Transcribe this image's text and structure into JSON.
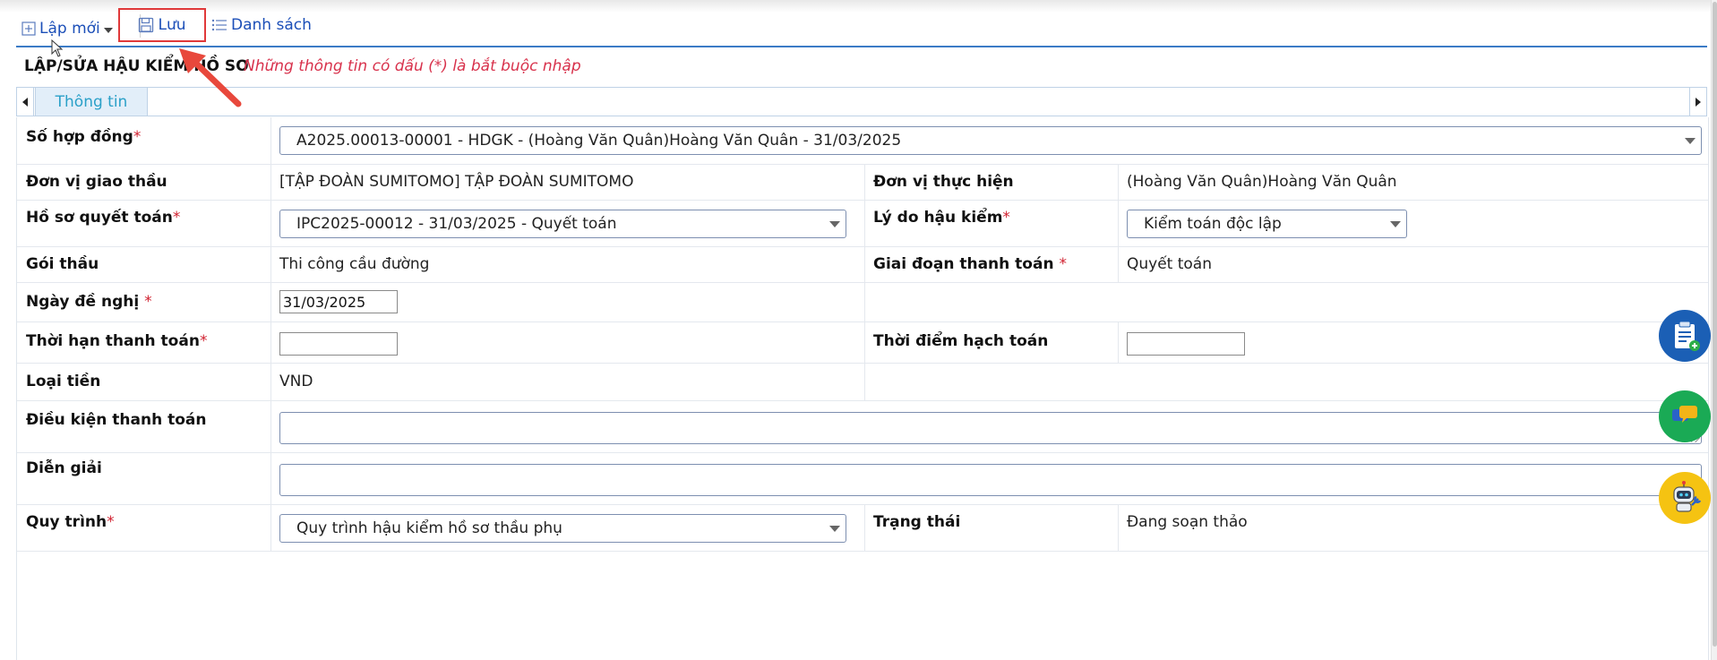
{
  "toolbar": {
    "new_label": "Lập mới",
    "save_label": "Lưu",
    "list_label": "Danh sách"
  },
  "header": {
    "title": "LẬP/SỬA HẬU KIỂM HỒ SƠ",
    "note": "Những thông tin có dấu (*) là bắt buộc nhập"
  },
  "tabs": [
    {
      "label": "Thông tin"
    }
  ],
  "form": {
    "contract_no": {
      "label": "Số hợp đồng",
      "value": "A2025.00013-00001 - HDGK - (Hoàng Văn Quân)Hoàng Văn Quân - 31/03/2025"
    },
    "contractor": {
      "label": "Đơn vị giao thầu",
      "value": "[TẬP ĐOÀN SUMITOMO] TẬP ĐOÀN SUMITOMO"
    },
    "executor": {
      "label": "Đơn vị thực hiện",
      "value": "(Hoàng Văn Quân)Hoàng Văn Quân"
    },
    "settlement_file": {
      "label": "Hồ sơ quyết toán",
      "value": "IPC2025-00012 - 31/03/2025 - Quyết toán"
    },
    "audit_reason": {
      "label": "Lý do hậu kiểm",
      "value": "Kiểm toán độc lập"
    },
    "package": {
      "label": "Gói thầu",
      "value": "Thi công cầu đường"
    },
    "payment_stage": {
      "label": "Giai đoạn thanh toán",
      "value": "Quyết toán"
    },
    "request_date": {
      "label": "Ngày đề nghị",
      "value": "31/03/2025"
    },
    "payment_due": {
      "label": "Thời hạn thanh toán",
      "value": ""
    },
    "accounting_time": {
      "label": "Thời điểm hạch toán",
      "value": ""
    },
    "currency": {
      "label": "Loại tiền",
      "value": "VND"
    },
    "payment_terms": {
      "label": "Điều kiện thanh toán",
      "value": ""
    },
    "description": {
      "label": "Diễn giải",
      "value": ""
    },
    "workflow": {
      "label": "Quy trình",
      "value": "Quy trình hậu kiểm hồ sơ thầu phụ"
    },
    "status": {
      "label": "Trạng thái",
      "value": "Đang soạn thảo"
    },
    "required_mark": "*"
  },
  "floating": [
    "clipboard-add-icon",
    "chat-icon",
    "robot-support-icon"
  ],
  "colors": {
    "link": "#1c4fb8",
    "required": "#d01f2e",
    "note": "#d8324c",
    "tab_text": "#2aa0c8",
    "highlight": "#e0393a"
  }
}
